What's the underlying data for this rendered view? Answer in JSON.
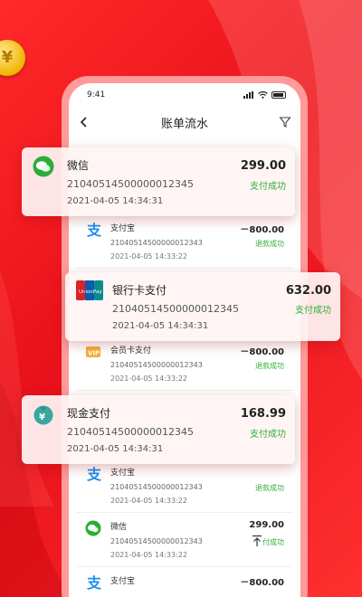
{
  "status_bar": {
    "time": "9:41"
  },
  "nav": {
    "title": "账单流水"
  },
  "list": [
    {
      "name": "支付宝",
      "amount": "－800.00",
      "id": "2104051450000001234​3",
      "time": "2021-04-05 14:33:22",
      "status": "退款成功",
      "icon": "alipay-icon"
    },
    {
      "name": "",
      "amount": "",
      "id": "",
      "time": "",
      "status": "",
      "icon": ""
    },
    {
      "name": "会员卡支付",
      "amount": "－800.00",
      "id": "21040514500000012343",
      "time": "2021-04-05 14:33:22",
      "status": "退款成功",
      "icon": "vip-icon"
    },
    {
      "name": "支付宝",
      "amount": "",
      "id": "21040514500000012343",
      "time": "2021-04-05 14:33:22",
      "status": "退款成功",
      "icon": "alipay-icon"
    },
    {
      "name": "微信",
      "amount": "299.00",
      "id": "21040514500000012343",
      "time": "2021-04-05 14:33:22",
      "status": "付成功",
      "icon": "wechat-icon"
    },
    {
      "name": "支付宝",
      "amount": "－800.00",
      "id": "",
      "time": "",
      "status": "",
      "icon": "alipay-icon"
    }
  ],
  "cards": [
    {
      "name": "微信",
      "id": "21040514500000012345",
      "time": "2021-04-05 14:34:31",
      "amount": "299.00",
      "status": "支付成功",
      "icon": "wechat-icon"
    },
    {
      "name": "银行卡支付",
      "id": "21040514500000012345",
      "time": "2021-04-05 14:34:31",
      "amount": "632.00",
      "status": "支付成功",
      "icon": "unionpay-icon",
      "logo_text": "UnionPay"
    },
    {
      "name": "现金支付",
      "id": "21040514500000012345",
      "time": "2021-04-05 14:34:31",
      "amount": "168.99",
      "status": "支付成功",
      "icon": "cash-icon"
    }
  ],
  "colors": {
    "brand_red": "#ff2a2a",
    "success_green": "#2fae3a"
  }
}
